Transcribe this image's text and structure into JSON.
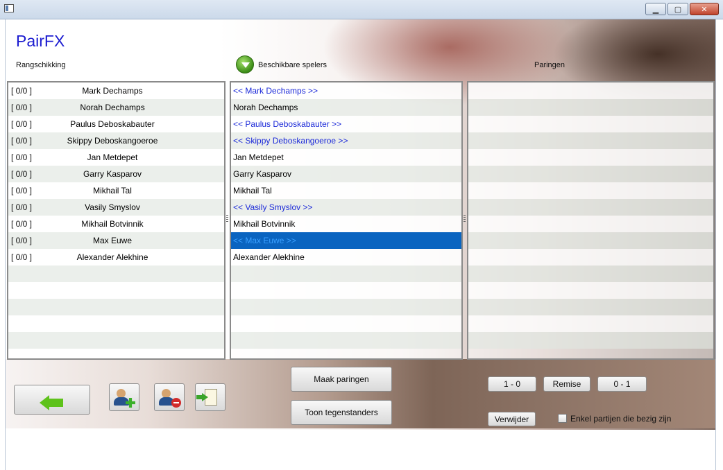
{
  "window": {
    "minimize_glyph": "▁",
    "maximize_glyph": "▢",
    "close_glyph": "✕"
  },
  "app": {
    "title": "PairFX"
  },
  "headers": {
    "ranking": "Rangschikking",
    "available": "Beschikbare spelers",
    "pairings": "Paringen"
  },
  "ranking": [
    {
      "score": "[  0/0  ]",
      "name": "Mark Dechamps"
    },
    {
      "score": "[  0/0  ]",
      "name": "Norah Dechamps"
    },
    {
      "score": "[  0/0  ]",
      "name": "Paulus Deboskabauter"
    },
    {
      "score": "[  0/0  ]",
      "name": "Skippy Deboskangoeroe"
    },
    {
      "score": "[  0/0  ]",
      "name": "Jan Metdepet"
    },
    {
      "score": "[  0/0  ]",
      "name": "Garry Kasparov"
    },
    {
      "score": "[  0/0  ]",
      "name": "Mikhail Tal"
    },
    {
      "score": "[  0/0  ]",
      "name": "Vasily Smyslov"
    },
    {
      "score": "[  0/0  ]",
      "name": "Mikhail Botvinnik"
    },
    {
      "score": "[  0/0  ]",
      "name": "Max Euwe"
    },
    {
      "score": "[  0/0  ]",
      "name": "Alexander Alekhine"
    }
  ],
  "available": [
    {
      "label": "<< Mark Dechamps >>",
      "paired": true
    },
    {
      "label": "Norah Dechamps",
      "paired": false
    },
    {
      "label": "<< Paulus Deboskabauter >>",
      "paired": true
    },
    {
      "label": "<< Skippy Deboskangoeroe >>",
      "paired": true
    },
    {
      "label": "Jan Metdepet",
      "paired": false
    },
    {
      "label": "Garry Kasparov",
      "paired": false
    },
    {
      "label": "Mikhail Tal",
      "paired": false
    },
    {
      "label": "<< Vasily Smyslov >>",
      "paired": true
    },
    {
      "label": "Mikhail Botvinnik",
      "paired": false
    },
    {
      "label": "<< Max Euwe >>",
      "paired": true,
      "selected": true
    },
    {
      "label": "Alexander Alekhine",
      "paired": false
    }
  ],
  "pairings": [],
  "buttons": {
    "make_pairings": "Maak paringen",
    "show_opponents": "Toon tegenstanders",
    "white_wins": "1 - 0",
    "draw": "Remise",
    "black_wins": "0 - 1",
    "remove": "Verwijder"
  },
  "filter": {
    "label": "Enkel partijen die bezig zijn",
    "checked": false
  },
  "colors": {
    "title": "#1b1bd0",
    "paired_text": "#1a28d8",
    "selection": "#0a64c0"
  }
}
